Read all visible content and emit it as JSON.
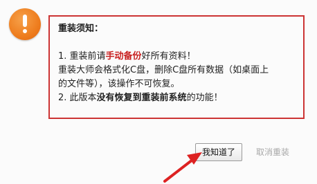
{
  "icon": {
    "name": "exclamation-icon",
    "color": "#ee7d1e"
  },
  "notice": {
    "title": "重装须知：",
    "line1_prefix": "1. 重装前请",
    "line1_highlight": "手动备份",
    "line1_suffix": "好所有资料！",
    "line2": "重装大师会格式化C盘，删除C盘所有数据（如桌面上",
    "line3": "的文件等），该操作不可恢复。",
    "line4_prefix": "2. 此版本",
    "line4_bold1": "没有恢复到重装前系统",
    "line4_suffix": "的功能！",
    "border_color": "#cc3333",
    "highlight_color": "#c81e1e"
  },
  "buttons": {
    "confirm_label": "我知道了",
    "cancel_label": "取消重装"
  },
  "annotation": {
    "arrow_color": "#dd2222"
  }
}
